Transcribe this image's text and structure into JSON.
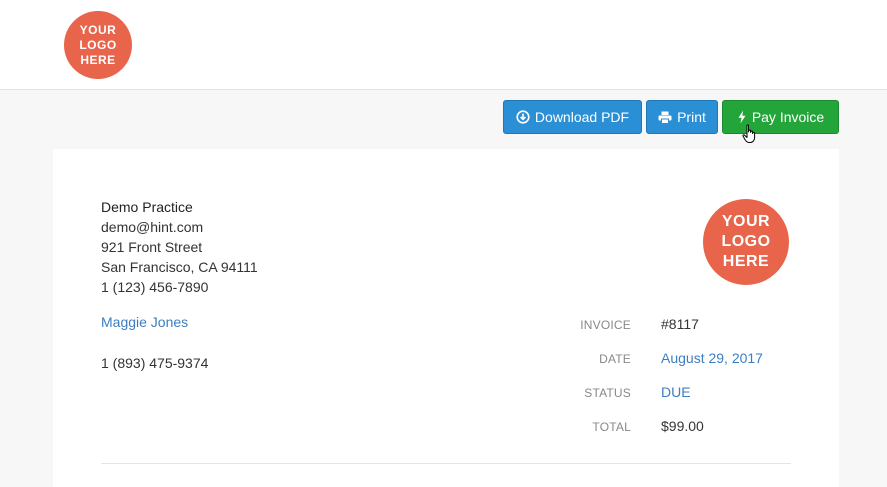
{
  "logo_text": "YOUR\nLOGO\nHERE",
  "toolbar": {
    "download_label": "Download PDF",
    "print_label": "Print",
    "pay_label": "Pay Invoice"
  },
  "practice": {
    "name": "Demo Practice",
    "email": "demo@hint.com",
    "street": "921 Front Street",
    "city": "San Francisco, CA 94111",
    "phone": "1 (123) 456-7890"
  },
  "patient": {
    "name": "Maggie Jones",
    "phone": "1 (893) 475-9374"
  },
  "invoice": {
    "invoice_label": "INVOICE",
    "invoice_number": "#8117",
    "date_label": "DATE",
    "date_value": "August 29, 2017",
    "status_label": "STATUS",
    "status_value": "DUE",
    "total_label": "TOTAL",
    "total_value": "$99.00"
  },
  "colors": {
    "primary_button": "#2a8fd4",
    "pay_button": "#24a53a",
    "link": "#3d7ebf",
    "logo": "#e8644a"
  }
}
